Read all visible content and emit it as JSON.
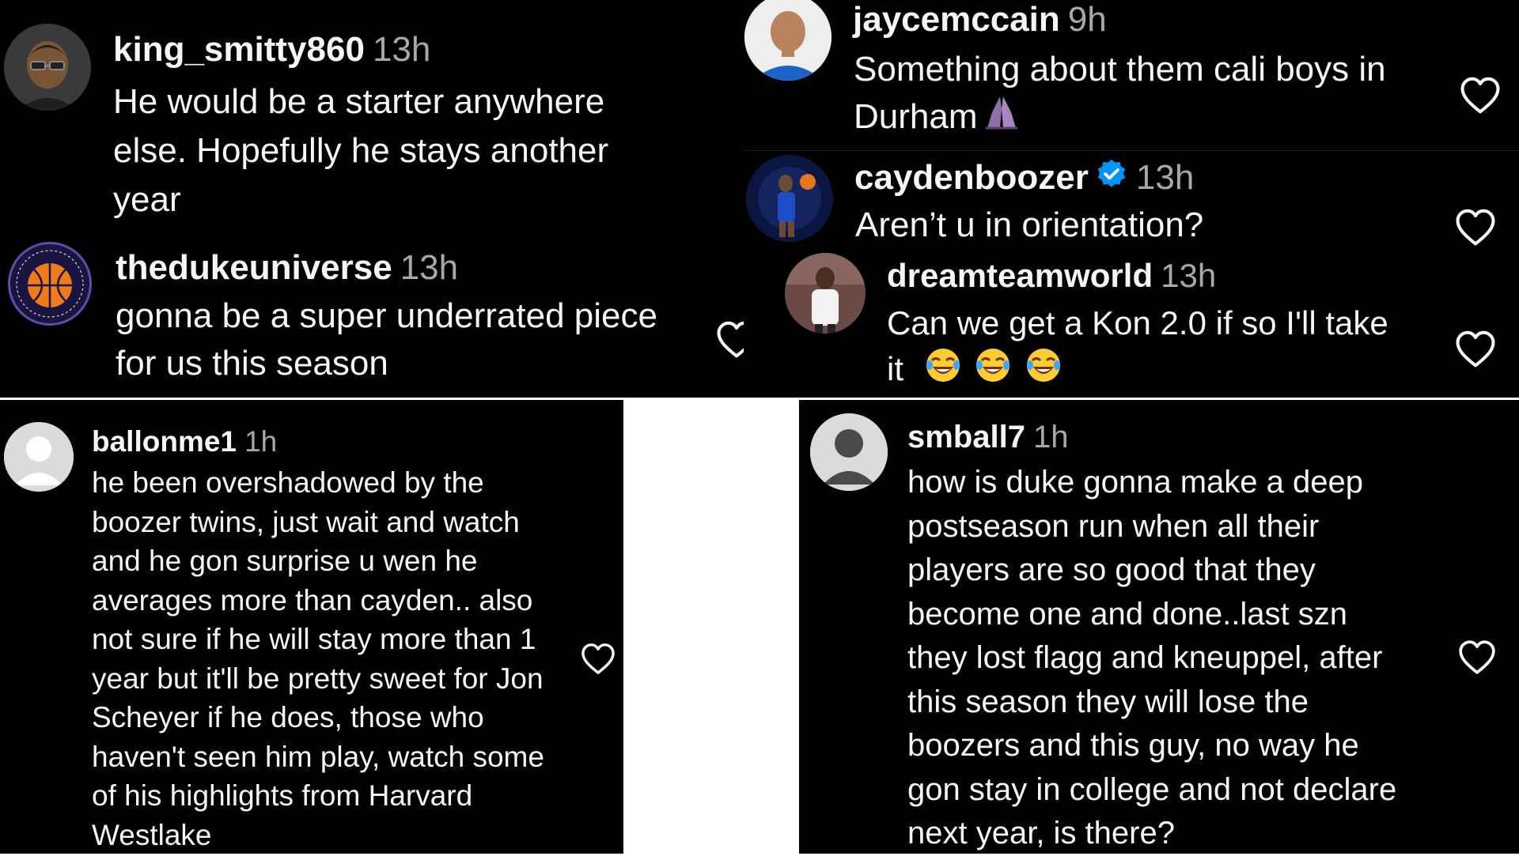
{
  "colors": {
    "background": "#000000",
    "text": "#f5f5f5",
    "muted": "#a8a8a8",
    "verified": "#0095f6",
    "separator": "#ffffff"
  },
  "top_left": {
    "comments": [
      {
        "username": "king_smitty860",
        "time": "13h",
        "text_lines": [
          "He would be a starter anywhere",
          "else. Hopefully he stays another",
          "year"
        ]
      },
      {
        "username": "thedukeuniverse",
        "time": "13h",
        "text_lines": [
          "gonna be a super underrated piece",
          "for us this season"
        ],
        "like_icon": "heart-outline-icon"
      }
    ]
  },
  "top_right": {
    "comments": [
      {
        "username": "jaycemccain",
        "time": "9h",
        "text_lines": [
          "Something about them cali boys in",
          "Durham"
        ],
        "emoji": "folded-hands-icon",
        "like_icon": "heart-outline-icon"
      },
      {
        "username": "caydenboozer",
        "verified": true,
        "time": "13h",
        "text_lines": [
          "Aren’t u in orientation?"
        ],
        "like_icon": "heart-outline-icon"
      },
      {
        "username": "dreamteamworld",
        "time": "13h",
        "text_lines": [
          "Can we get a Kon 2.0 if so I'll take",
          "it"
        ],
        "emojis": [
          "laughing-tears-icon",
          "laughing-tears-icon",
          "laughing-tears-icon"
        ],
        "like_icon": "heart-outline-icon"
      }
    ]
  },
  "bottom_left": {
    "username": "ballonme1",
    "time": "1h",
    "text_lines": [
      "he been overshadowed by the",
      "boozer twins, just wait and watch",
      "and he gon surprise u wen he",
      "averages more than cayden.. also",
      "not sure if he will stay more than 1",
      "year but it'll be pretty sweet for Jon",
      "Scheyer if he does, those who",
      "haven't seen him play, watch some",
      "of his highlights from Harvard",
      "Westlake"
    ],
    "like_icon": "heart-outline-icon"
  },
  "bottom_right": {
    "username": "smball7",
    "time": "1h",
    "text_lines": [
      "how is duke gonna make a deep",
      "postseason run when all their",
      "players are so good that they",
      "become one and done..last szn",
      "they lost flagg and kneuppel, after",
      "this season they will lose the",
      "boozers and this guy, no way he",
      "gon stay in college and not declare",
      "next year, is there?"
    ],
    "like_icon": "heart-outline-icon"
  }
}
